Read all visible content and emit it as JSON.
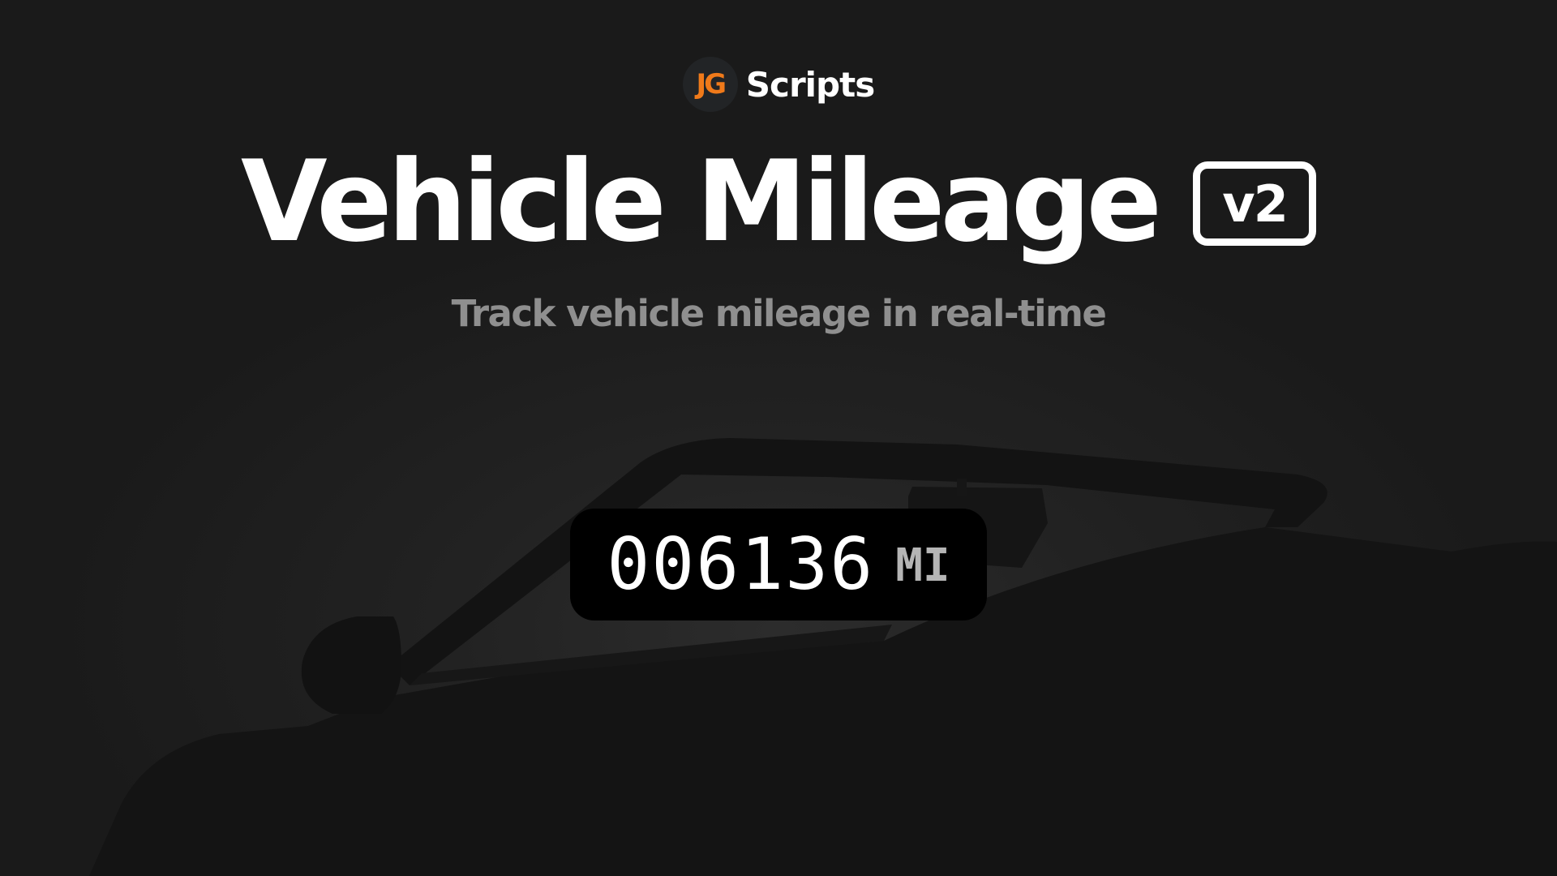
{
  "brand": {
    "logo_text": "JG",
    "name": "Scripts",
    "logo_color": "#f07a1a"
  },
  "header": {
    "title": "Vehicle Mileage",
    "version": "v2",
    "subtitle": "Track vehicle mileage in real-time"
  },
  "odometer": {
    "value": "006136",
    "unit": "MI"
  },
  "colors": {
    "background": "#1b1b1b",
    "odometer_background": "#000000",
    "title": "#ffffff",
    "subtitle": "#8f8f8f"
  },
  "icons": {
    "background_art": "car-silhouette-icon"
  }
}
